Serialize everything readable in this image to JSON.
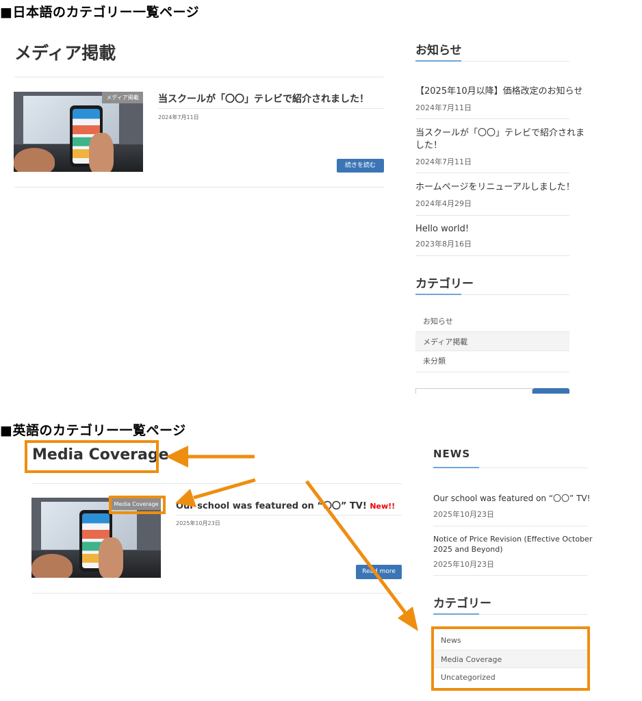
{
  "jp_section": {
    "heading": "■日本語のカテゴリー一覧ページ",
    "page_title": "メディア掲載",
    "post": {
      "badge": "メディア掲載",
      "title": "当スクールが「〇〇」テレビで紹介されました！",
      "date": "2024年7月11日",
      "more": "続きを読む"
    },
    "sidebar": {
      "news_title": "お知らせ",
      "news": [
        {
          "title": "【2025年10月以降】価格改定のお知らせ",
          "date": "2024年7月11日"
        },
        {
          "title_line1": "当スクールが「〇〇」テレビで紹介されま",
          "title_line2": "した！",
          "date": "2024年7月11日"
        },
        {
          "title": "ホームページをリニューアルしました！",
          "date": "2024年4月29日"
        },
        {
          "title": "Hello world!",
          "date": "2023年8月16日"
        }
      ],
      "category_title": "カテゴリー",
      "categories": [
        "お知らせ",
        "メディア掲載",
        "未分類"
      ]
    }
  },
  "en_section": {
    "heading": "■英語のカテゴリー一覧ページ",
    "page_title": "Media Coverage",
    "post": {
      "badge": "Media Coverage",
      "title": "Our school was featured on “〇〇” TV!",
      "new_label": "New!!",
      "date": "2025年10月23日",
      "more": "Read more"
    },
    "sidebar": {
      "news_title": "NEWS",
      "news": [
        {
          "title": "Our school was featured on “〇〇” TV!",
          "date": "2025年10月23日"
        },
        {
          "title_line1": "Notice of Price Revision (Effective October",
          "title_line2": "2025 and Beyond)",
          "date": "2025年10月23日"
        }
      ],
      "category_title": "カテゴリー",
      "categories": [
        "News",
        "Media Coverage",
        "Uncategorized"
      ]
    }
  },
  "colors": {
    "annotation": "#ee8e10",
    "button": "#3b75b5",
    "badge": "#8e8e8e",
    "new_label": "#e00000"
  }
}
